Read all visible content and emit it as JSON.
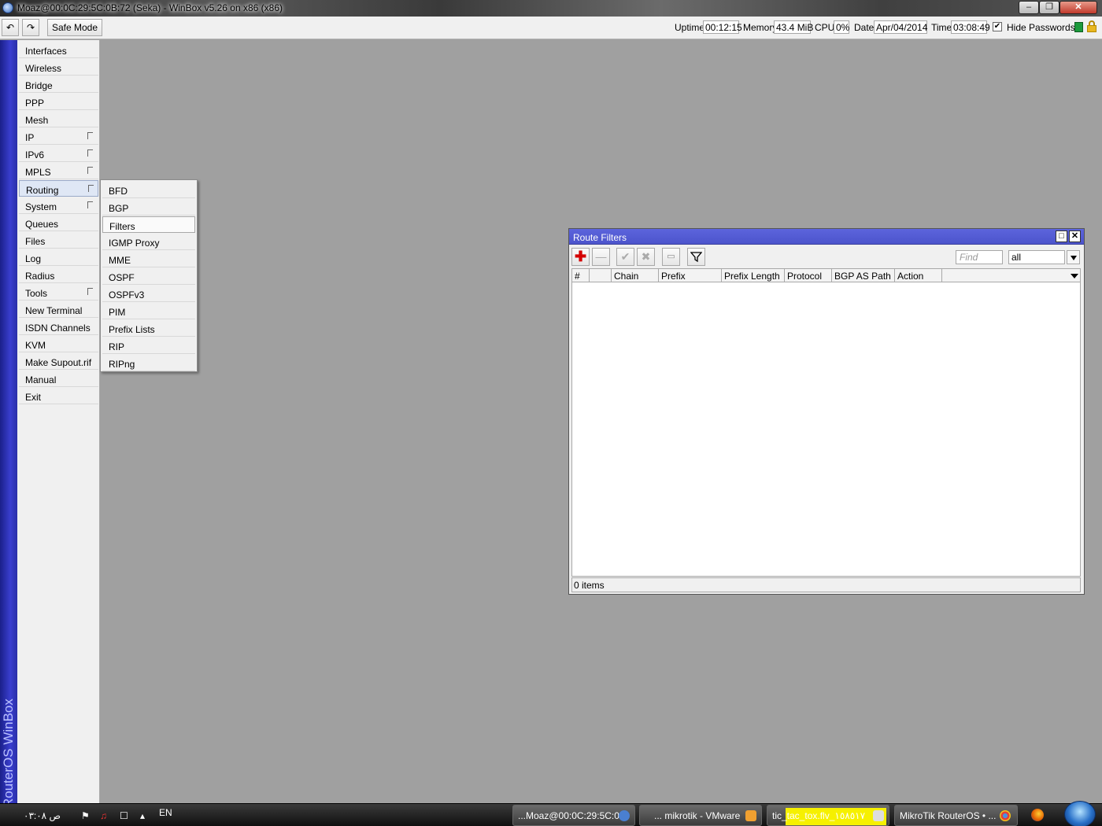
{
  "titlebar": {
    "title": "Moaz@00:0C:29:5C:0B:72 (Seka) - WinBox v5.26 on x86 (x86)",
    "minimize_glyph": "–",
    "maximize_glyph": "❐",
    "close_glyph": "✕"
  },
  "toolbar": {
    "undo_glyph": "↶",
    "redo_glyph": "↷",
    "safe_mode": "Safe Mode",
    "uptime_label": "Uptime:",
    "uptime_value": "00:12:15",
    "memory_label": "Memory:",
    "memory_value": "43.4 MiB",
    "cpu_label": "CPU:",
    "cpu_value": "0%",
    "date_label": "Date:",
    "date_value": "Apr/04/2014",
    "time_label": "Time:",
    "time_value": "03:08:49",
    "hide_passwords": "Hide Passwords",
    "hide_passwords_checked": true,
    "check_glyph": "✔",
    "status_color": "#1c9a3c"
  },
  "brand": {
    "text": "RouterOS WinBox",
    "color": "#3a3fcf"
  },
  "sidemenu": {
    "items": [
      {
        "label": "Interfaces",
        "has_submenu": false
      },
      {
        "label": "Wireless",
        "has_submenu": false
      },
      {
        "label": "Bridge",
        "has_submenu": false
      },
      {
        "label": "PPP",
        "has_submenu": false
      },
      {
        "label": "Mesh",
        "has_submenu": false
      },
      {
        "label": "IP",
        "has_submenu": true
      },
      {
        "label": "IPv6",
        "has_submenu": true
      },
      {
        "label": "MPLS",
        "has_submenu": true
      },
      {
        "label": "Routing",
        "has_submenu": true,
        "active": true
      },
      {
        "label": "System",
        "has_submenu": true
      },
      {
        "label": "Queues",
        "has_submenu": false
      },
      {
        "label": "Files",
        "has_submenu": false
      },
      {
        "label": "Log",
        "has_submenu": false
      },
      {
        "label": "Radius",
        "has_submenu": false
      },
      {
        "label": "Tools",
        "has_submenu": true
      },
      {
        "label": "New Terminal",
        "has_submenu": false
      },
      {
        "label": "ISDN Channels",
        "has_submenu": false
      },
      {
        "label": "KVM",
        "has_submenu": false
      },
      {
        "label": "Make Supout.rif",
        "has_submenu": false
      },
      {
        "label": "Manual",
        "has_submenu": false
      },
      {
        "label": "Exit",
        "has_submenu": false
      }
    ]
  },
  "submenu": {
    "items": [
      {
        "label": "BFD"
      },
      {
        "label": "BGP"
      },
      {
        "label": "Filters",
        "hover": true
      },
      {
        "label": "IGMP Proxy"
      },
      {
        "label": "MME"
      },
      {
        "label": "OSPF"
      },
      {
        "label": "OSPFv3"
      },
      {
        "label": "PIM"
      },
      {
        "label": "Prefix Lists"
      },
      {
        "label": "RIP"
      },
      {
        "label": "RIPng"
      }
    ]
  },
  "route_filters": {
    "title": "Route Filters",
    "maximize_glyph": "□",
    "close_glyph": "✕",
    "add_glyph": "✚",
    "remove_glyph": "—",
    "enable_glyph": "✔",
    "disable_glyph": "✖",
    "comment_glyph": "▭",
    "filter_glyph": "⏷",
    "find_placeholder": "Find",
    "select_value": "all",
    "columns": [
      "#",
      "",
      "Chain",
      "Prefix",
      "Prefix Length",
      "Protocol",
      "BGP AS Path",
      "Action"
    ],
    "rows": [],
    "status": "0 items",
    "accent_color": "#4c54cc"
  },
  "taskbar": {
    "clock": "۰۳:۰۸ ص",
    "lang": "EN",
    "flag_glyph": "⚑",
    "volume_glyph": "♫",
    "network_glyph": "☐",
    "arrow_glyph": "▴",
    "tasks": [
      {
        "label": "...Moaz@00:0C:29:5C:0",
        "icon": "winbox-icon"
      },
      {
        "label": "... mikrotik - VMware",
        "icon": "vmware-icon"
      },
      {
        "label": "tic_tac_tox.flv_١٥٨٥١٧",
        "icon": "video-icon"
      },
      {
        "label": "MikroTik RouterOS • ...",
        "icon": "chrome-icon"
      }
    ]
  }
}
